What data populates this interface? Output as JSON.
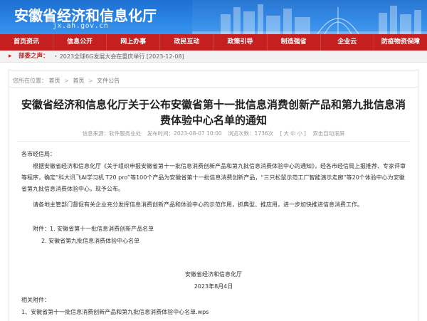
{
  "header": {
    "site_title": "安徽省经济和信息化厅",
    "site_domain": "jx.ah.gov.cn"
  },
  "nav": {
    "items": [
      {
        "label": "首页资讯"
      },
      {
        "label": "信息公开"
      },
      {
        "label": "网上办事"
      },
      {
        "label": "政民互动"
      },
      {
        "label": "政策引导"
      },
      {
        "label": "制造强省"
      },
      {
        "label": "企业云"
      },
      {
        "label": "防疫物资保障"
      }
    ]
  },
  "ticker": {
    "label": "部委之声：",
    "message": "2023全球6G发展大会在重庆举行 [2023-12-08]",
    "accent_color": "#c51f1f"
  },
  "breadcrumb": {
    "prefix": "您所在位置：",
    "items": [
      "首页",
      "首页",
      "文件公告"
    ]
  },
  "article": {
    "title": "安徽省经济和信息化厅关于公布安徽省第十一批信息消费创新产品和第九批信息消费体验中心名单的通知",
    "meta": {
      "source": "信息来源：软件服务业处",
      "date": "发布时间：2023-08-07 10:00",
      "views": "浏览次数：1736次",
      "size_prefix": "[",
      "size_large": "大",
      "size_medium": "中",
      "size_small": "小",
      "size_suffix": "]",
      "auto_scroll": "双击自动滚屏"
    },
    "salutation": "各市经信局：",
    "paragraph1": "根据安徽省经济和信息化厅《关于组织申报安徽省第十一批信息消费创新产品和第九批信息消费体验中心的通知》，经各市经信局上报推荐、专家评审等程序，确定“科大讯飞AI学习机 T20 pro”等100个产品为安徽省第十一批信息消费创新产品，“三只松鼠示范工厂智能演示走廊”等20个体验中心为安徽省第九批信息消费体验中心，现予公布。",
    "paragraph2": "请各地主管部门督促有关企业充分发挥信息消费创新产品和体验中心的示范作用，抓典型、推应用，进一步加快推进信息消费工作。",
    "attachment1": "附件：1. 安徽省第十一批信息消费创新产品名单",
    "attachment2": "2. 安徽省第九批信息消费体验中心名单",
    "sign_org": "安徽省经济和信息化厅",
    "sign_date": "2023年8月4日",
    "related_label": "相关附件：",
    "related_item": "1、安徽省第十一批信息消费创新产品和第九批信息消费体验中心名单.wps"
  }
}
